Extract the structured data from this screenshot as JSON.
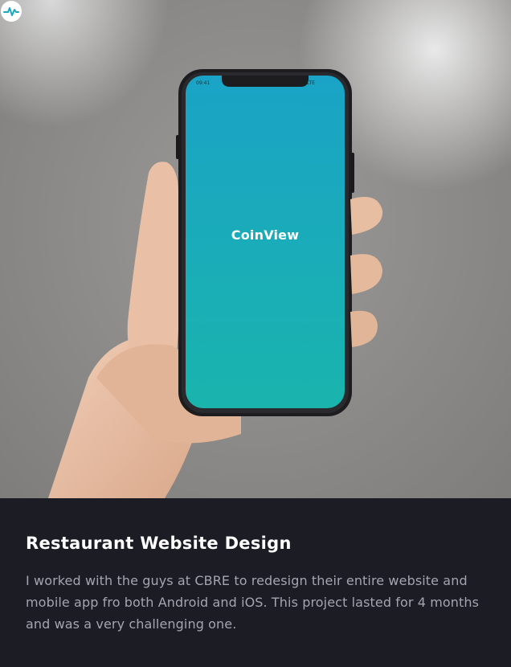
{
  "project": {
    "title": "Restaurant Website Design",
    "description": "I worked with the guys at CBRE to redesign their entire website and mobile app fro both Android and iOS. This project lasted for 4 months and was a very challenging one."
  },
  "photo": {
    "app_name": "CoinView",
    "app_logo_icon": "coinview-logo-icon",
    "screen_gradient": [
      "#1aa3c4",
      "#1ab3b0"
    ],
    "status_time": "09:41",
    "status_right": "LTE"
  },
  "colors": {
    "background": "#1b1c24",
    "title": "#ffffff",
    "description": "#a3a5af"
  }
}
